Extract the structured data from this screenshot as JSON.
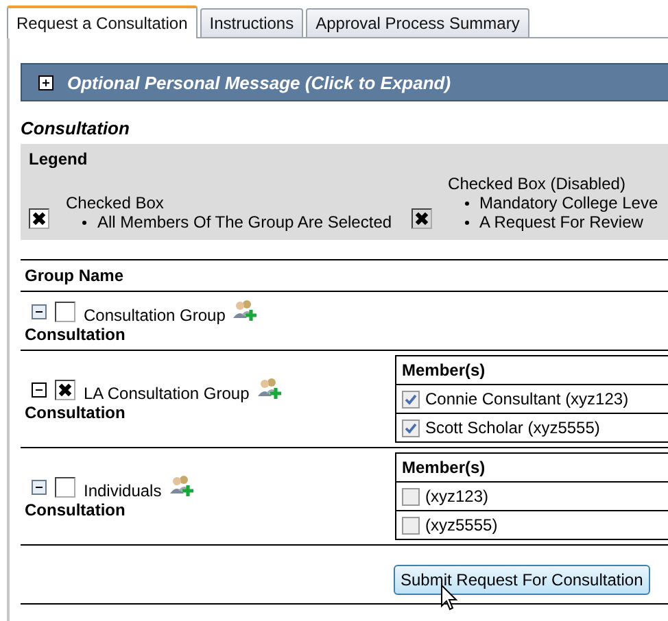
{
  "tabs": [
    {
      "label": "Request a Consultation",
      "selected": true
    },
    {
      "label": "Instructions",
      "selected": false
    },
    {
      "label": "Approval Process Summary",
      "selected": false
    }
  ],
  "message_bar": {
    "title": "Optional Personal Message (Click to Expand)",
    "expanded": false
  },
  "section_title": "Consultation",
  "legend": {
    "title": "Legend",
    "items": [
      {
        "checked": true,
        "disabled": false,
        "title": "Checked Box",
        "bullets": [
          "All Members Of The Group Are Selected"
        ]
      },
      {
        "checked": true,
        "disabled": true,
        "title": "Checked Box (Disabled)",
        "bullets": [
          "Mandatory College Leve",
          "A Request For Review"
        ]
      }
    ]
  },
  "groups_table": {
    "header": "Group Name",
    "groups": [
      {
        "name": "Consultation Group",
        "type": "Consultation",
        "checked": false,
        "expanded": true
      },
      {
        "name": "LA Consultation Group",
        "type": "Consultation",
        "checked": true,
        "expanded": true,
        "members_header": "Member(s)",
        "members": [
          {
            "name": "Connie Consultant (xyz123)",
            "checked": true
          },
          {
            "name": "Scott Scholar (xyz5555)",
            "checked": true
          }
        ]
      },
      {
        "name": "Individuals",
        "type": "Consultation",
        "checked": false,
        "expanded": true,
        "members_header": "Member(s)",
        "members": [
          {
            "name": "(xyz123)",
            "checked": false
          },
          {
            "name": "(xyz5555)",
            "checked": false
          }
        ]
      }
    ]
  },
  "submit_button": "Submit Request For Consultation"
}
